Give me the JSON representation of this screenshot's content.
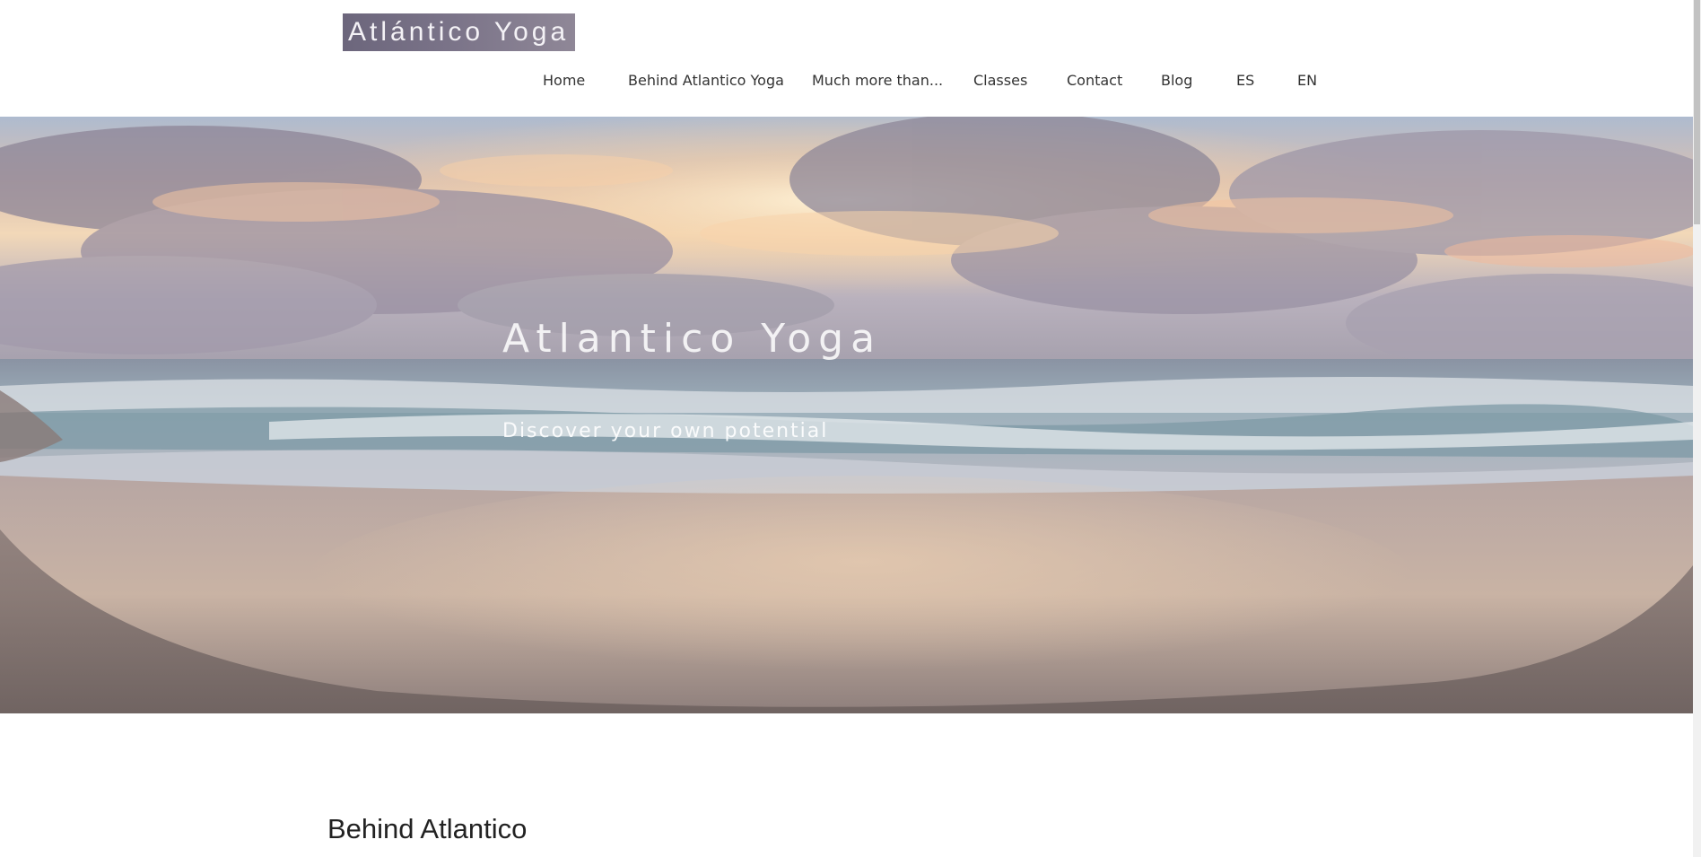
{
  "header": {
    "logo_text": "Atlántico Yoga",
    "nav": [
      {
        "label": "Home"
      },
      {
        "label": "Behind Atlantico Yoga"
      },
      {
        "label": "Much more than..."
      },
      {
        "label": "Classes"
      },
      {
        "label": "Contact"
      },
      {
        "label": "Blog"
      },
      {
        "label": "ES"
      },
      {
        "label": "EN"
      }
    ]
  },
  "hero": {
    "title": "Atlantico Yoga",
    "subtitle": "Discover your own potential"
  },
  "section": {
    "heading": "Behind Atlantico"
  },
  "colors": {
    "logo_bg": "#7a7388",
    "nav_text": "#333333",
    "heading_text": "#222222"
  }
}
